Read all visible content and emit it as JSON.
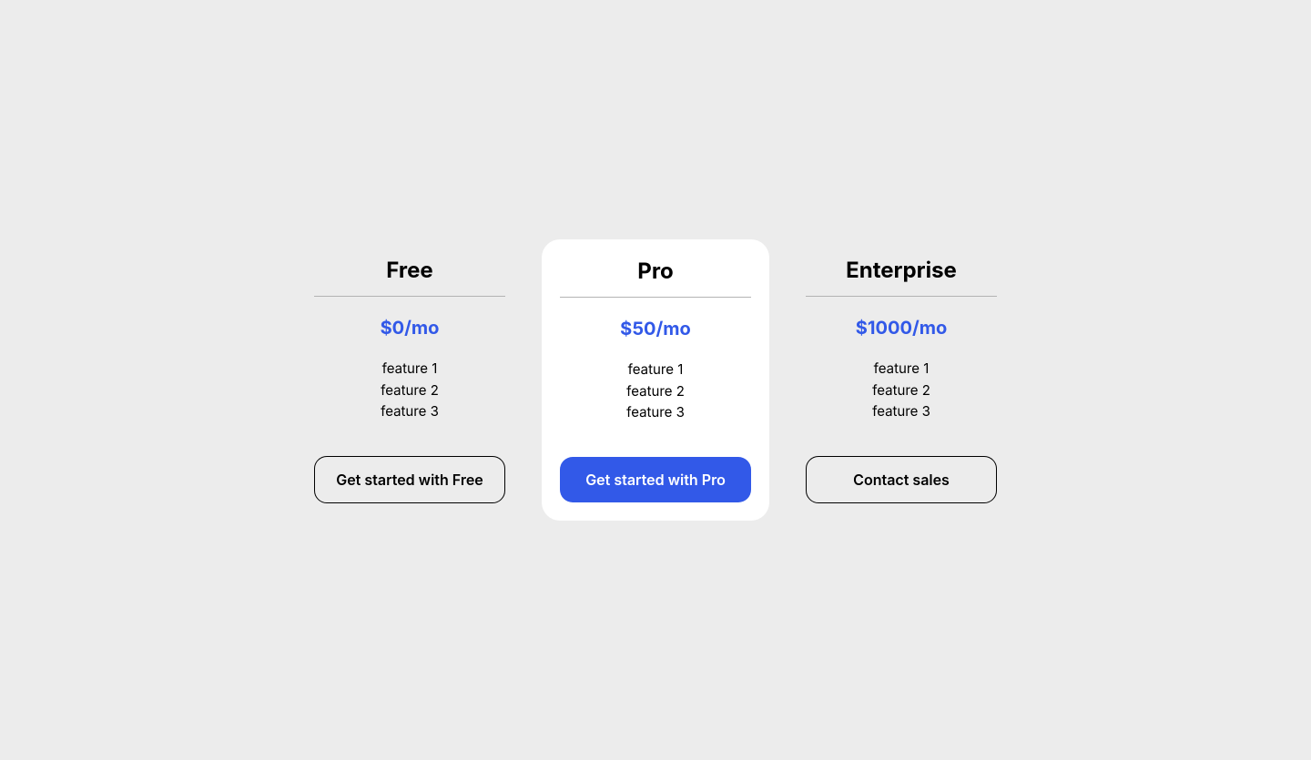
{
  "pricing": {
    "tiers": [
      {
        "name": "Free",
        "price": "$0/mo",
        "features": [
          "feature 1",
          "feature 2",
          "feature 3"
        ],
        "cta": "Get started with Free",
        "featured": false,
        "button_style": "outline"
      },
      {
        "name": "Pro",
        "price": "$50/mo",
        "features": [
          "feature 1",
          "feature 2",
          "feature 3"
        ],
        "cta": "Get started with Pro",
        "featured": true,
        "button_style": "primary"
      },
      {
        "name": "Enterprise",
        "price": "$1000/mo",
        "features": [
          "feature 1",
          "feature 2",
          "feature 3"
        ],
        "cta": "Contact sales",
        "featured": false,
        "button_style": "outline"
      }
    ]
  },
  "colors": {
    "accent": "#3259e8",
    "background": "#ececec",
    "card_bg": "#ffffff"
  }
}
